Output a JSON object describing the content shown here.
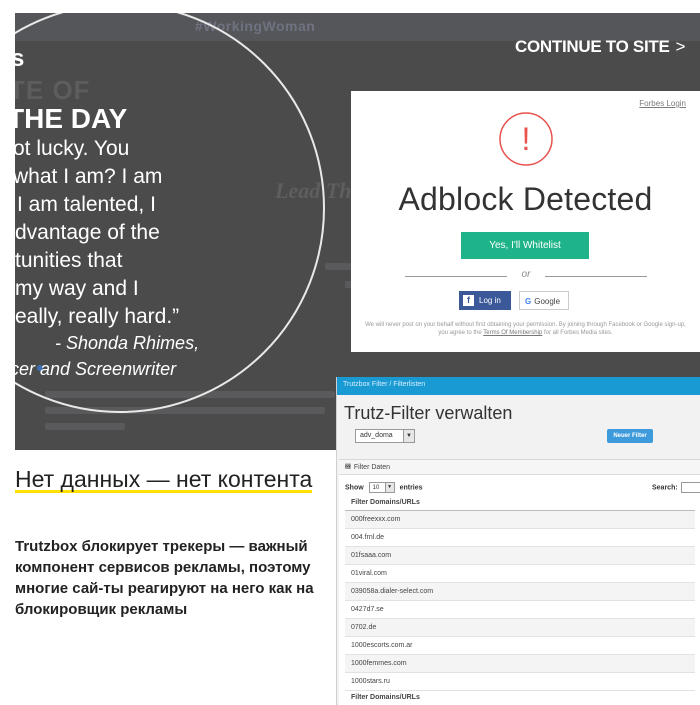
{
  "forbes": {
    "continue_label": "CONTINUE TO SITE",
    "continue_chevron": ">",
    "blurred_tag": "#WorkingWoman",
    "blurred_title": "Lead The Playin",
    "quote": {
      "brand": "s",
      "kicker": "TE OF",
      "heading": "THE DAY",
      "lines": [
        "ot lucky. You",
        "what I am? I am",
        "I am talented, I",
        "dvantage of the",
        "tunities that",
        "my way and I",
        "eally, really hard.”"
      ],
      "author": "- Shonda Rhimes,",
      "role": "ucer and Screenwriter"
    },
    "modal": {
      "forbes_login": "Forbes Login",
      "alert_glyph": "!",
      "headline": "Adblock Detected",
      "whitelist_button": "Yes, I'll Whitelist",
      "or_label": "or",
      "facebook_login": "Log in",
      "facebook_glyph": "f",
      "google_login": "Google",
      "google_glyph": "G",
      "legal_text": "We will never post on your behalf without first obtaining your permission. By joining through Facebook or Google sign-up, you agree to the",
      "legal_link": "Terms Of Membership",
      "legal_tail": "for all Forbes Media sites."
    }
  },
  "article": {
    "title": "Нет данных — нет контента",
    "body": "Trutzbox блокирует трекеры — важный компонент сервисов рекламы, поэтому многие сай-ты реагируют на него как на блокировщик рекламы"
  },
  "trutzbox": {
    "breadcrumb": "Trutzbox Filter  /  Filterlisten",
    "page_title": "Trutz-Filter verwalten",
    "select_value": "adv_doma",
    "select_arrow": "▼",
    "new_filter_button": "Neuer Filter",
    "panel_icon": "łłł",
    "panel_title": "Filter Daten",
    "show_label": "Show",
    "entries_value": "10",
    "entries_label": "entries",
    "search_label": "Search:",
    "column_header": "Filter Domains/URLs",
    "rows": [
      "000freexxx.com",
      "004.frnl.de",
      "01fsaaa.com",
      "01viral.com",
      "039058a.dialer-select.com",
      "0427d7.se",
      "0702.de",
      "1000escorts.com.ar",
      "1000femmes.com",
      "1000stars.ru"
    ],
    "footer_header": "Filter Domains/URLs"
  },
  "colors": {
    "overlay_bg": "#4b4b4c",
    "whitelist_green": "#1fb389",
    "alert_red": "#e8524f",
    "facebook_blue": "#3b5998",
    "trutz_bar": "#1a9ad3",
    "highlight_yellow": "#ffe000"
  }
}
